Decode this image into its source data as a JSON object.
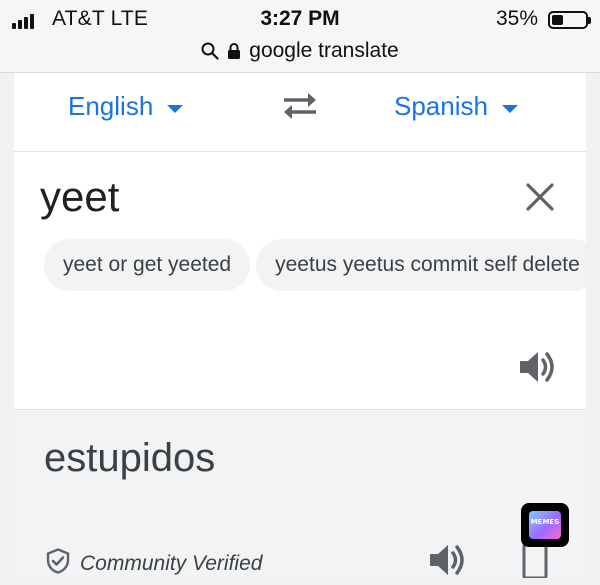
{
  "status_bar": {
    "carrier": "AT&T   LTE",
    "time": "3:27 PM",
    "battery_percent": "35%",
    "battery_level": 0.35,
    "signal_bars": 4
  },
  "url_bar": {
    "text": "google translate",
    "icons": [
      "search-icon",
      "lock-icon"
    ]
  },
  "languages": {
    "source": "English",
    "target": "Spanish",
    "swap_icon": "swap-arrows-icon",
    "accent": "#1a73e8"
  },
  "input": {
    "text": "yeet",
    "clear_icon": "close-icon"
  },
  "suggestions": [
    "yeet or get yeeted",
    "yeetus yeetus commit self delete"
  ],
  "output": {
    "text": "estupidos",
    "badge": "Community Verified",
    "badge_icon": "shield-check-icon"
  },
  "watermark": {
    "label": "MEMES"
  }
}
